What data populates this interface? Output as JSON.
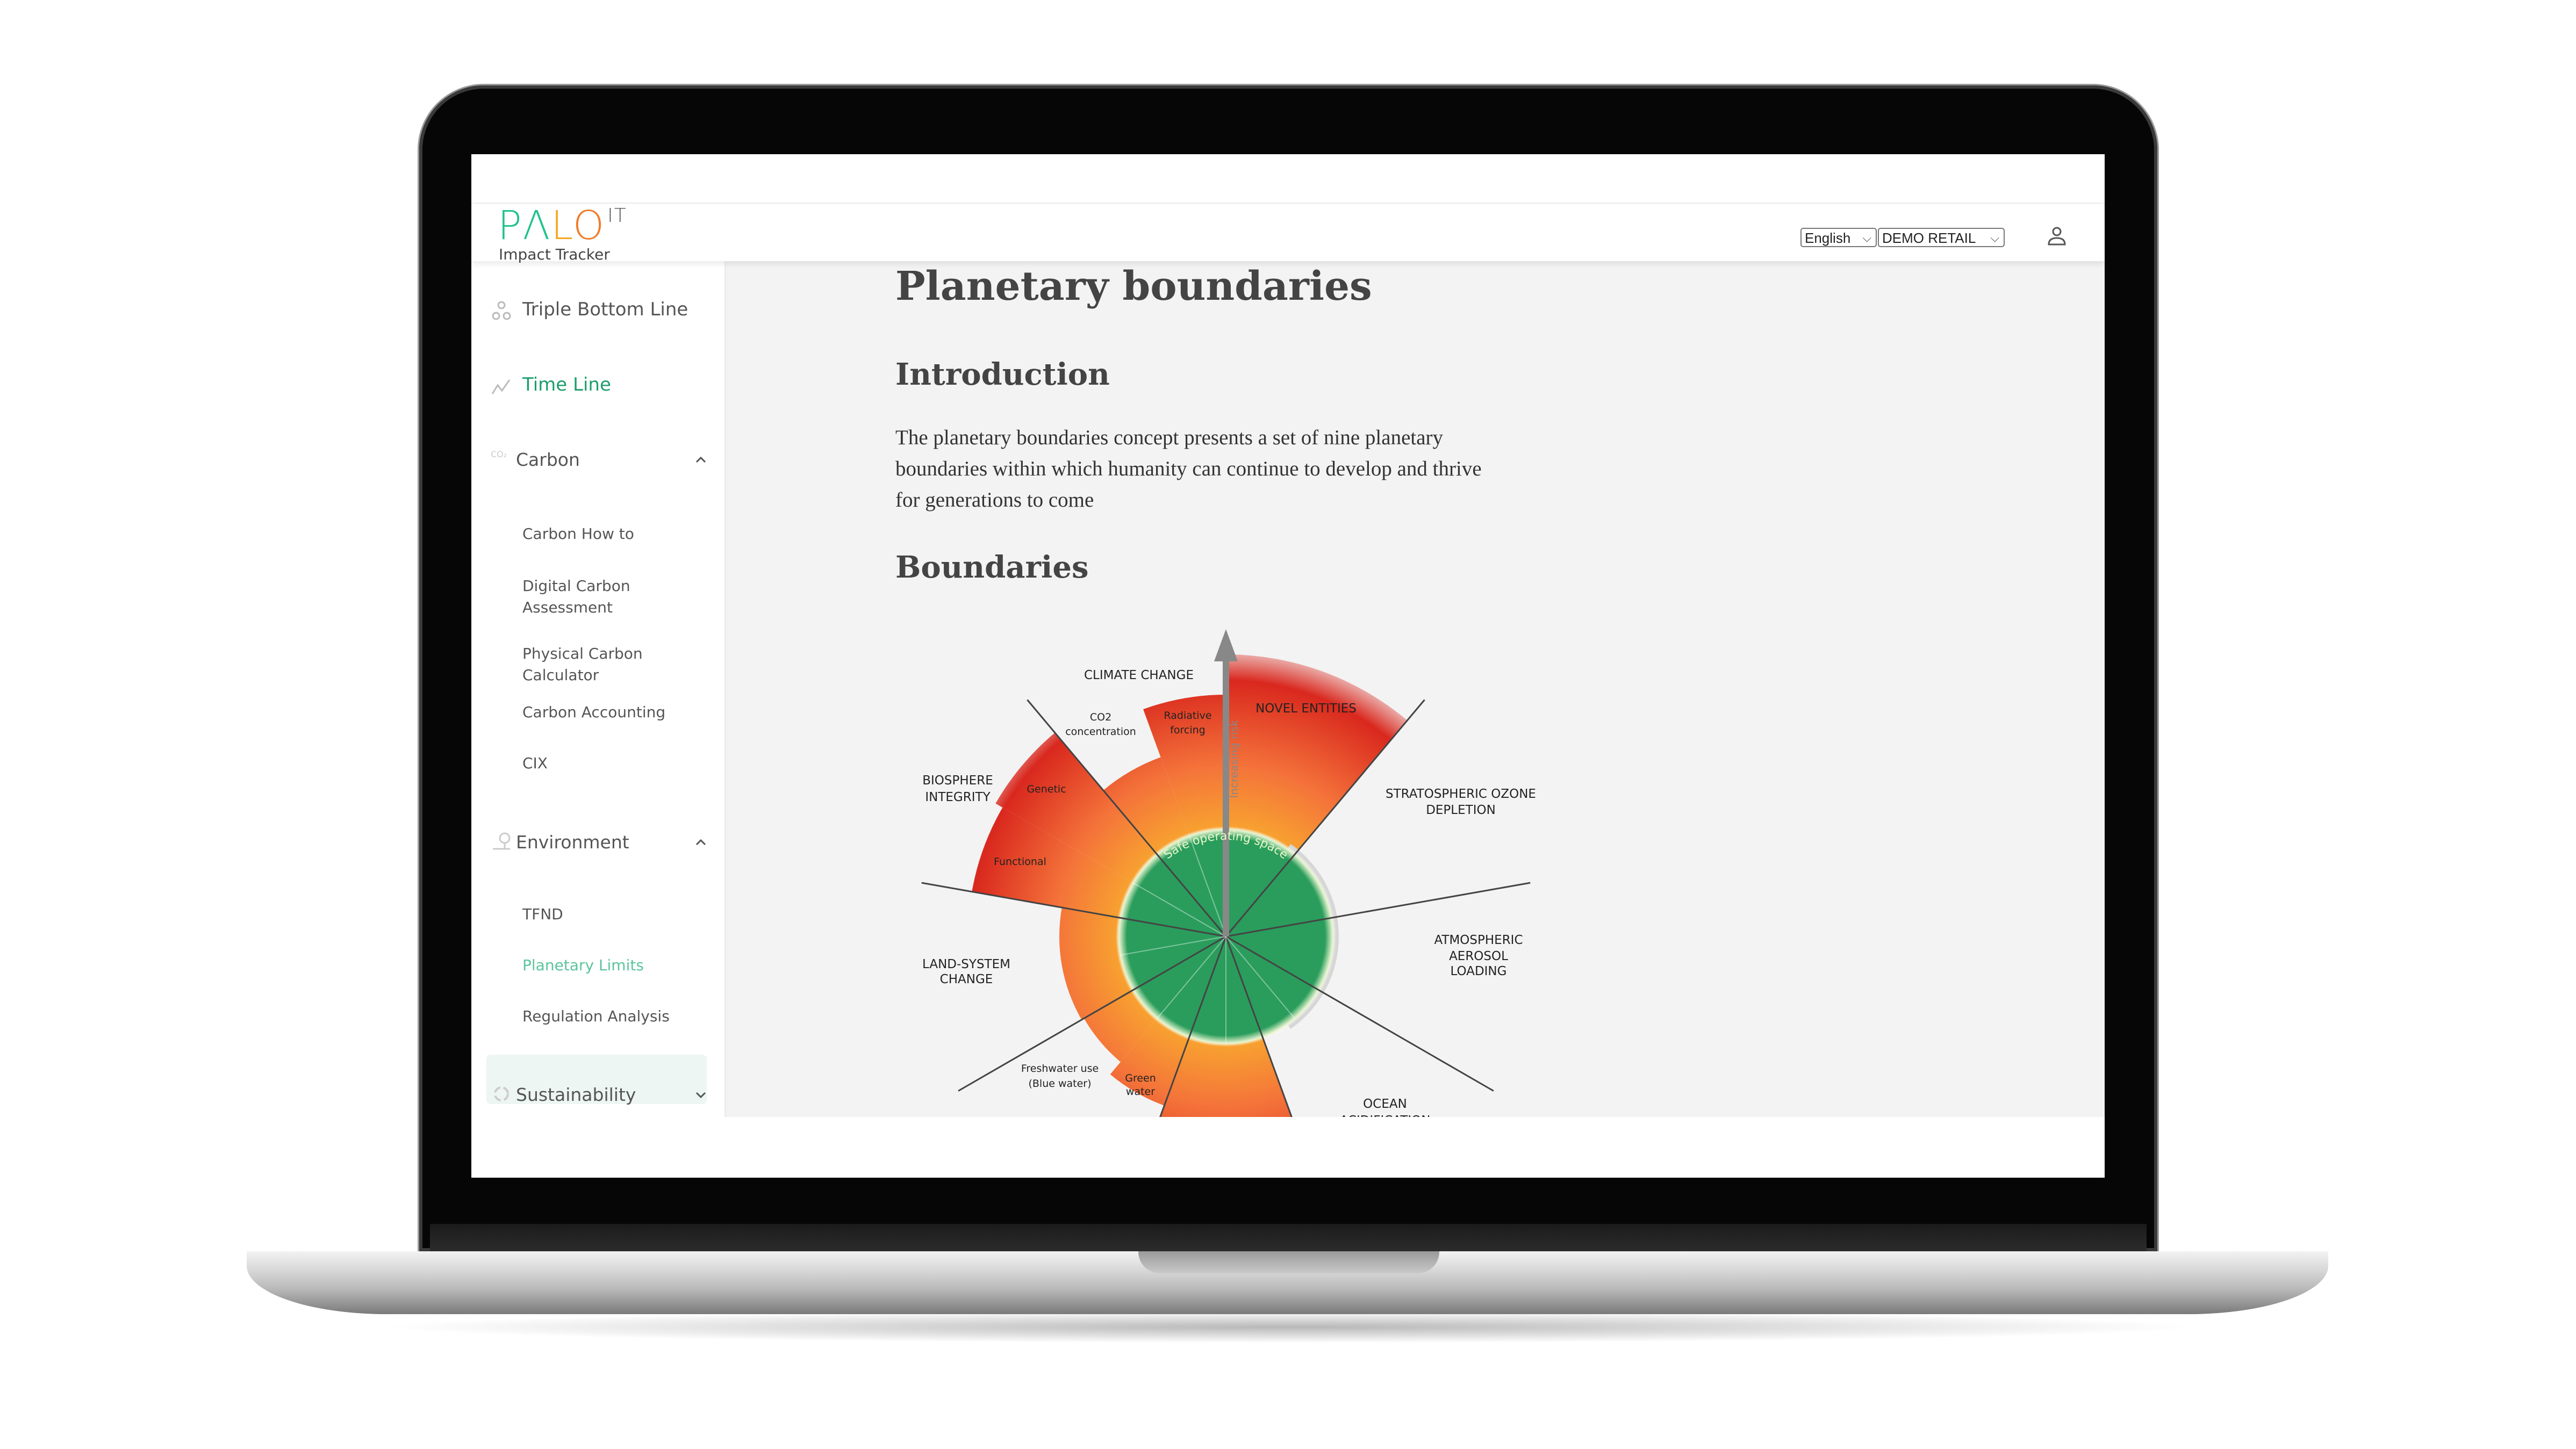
{
  "app": {
    "logo_text": "PALO IT",
    "logo_sub": "Impact Tracker"
  },
  "header": {
    "language": "English",
    "organization": "DEMO RETAIL",
    "user_icon": "user-icon"
  },
  "sidebar": {
    "triple_bottom_line": "Triple Bottom Line",
    "time_line": "Time Line",
    "carbon": {
      "label": "Carbon",
      "items": [
        "Carbon How to",
        "Digital Carbon Assessment",
        "Physical Carbon Calculator",
        "Carbon Accounting",
        "CIX"
      ]
    },
    "environment": {
      "label": "Environment",
      "items": [
        "TFND",
        "Planetary Limits",
        "Regulation Analysis"
      ]
    },
    "sustainability": "Sustainability",
    "active_item": "Planetary Limits"
  },
  "main": {
    "title": "Planetary boundaries",
    "intro_heading": "Introduction",
    "intro_lines": [
      "The planetary boundaries concept presents a set of nine planetary",
      "boundaries within which humanity can continue to develop and thrive",
      "for generations to come"
    ],
    "boundaries_heading": "Boundaries"
  },
  "diagram": {
    "climate_change": "CLIMATE CHANGE",
    "co2": [
      "CO2",
      "concentration"
    ],
    "radiative": [
      "Radiative",
      "forcing"
    ],
    "novel_entities": "NOVEL ENTITIES",
    "ozone": [
      "STRATOSPHERIC OZONE",
      "DEPLETION"
    ],
    "biosphere": [
      "BIOSPHERE",
      "INTEGRITY"
    ],
    "genetic": "Genetic",
    "functional": "Functional",
    "aerosol": [
      "ATMOSPHERIC",
      "AEROSOL",
      "LOADING"
    ],
    "land": [
      "LAND-SYSTEM",
      "CHANGE"
    ],
    "blue_water": [
      "Freshwater use",
      "(Blue water)"
    ],
    "green_water": [
      "Green",
      "water"
    ],
    "ocean": [
      "OCEAN",
      "ACIDIFICATION"
    ],
    "safe_space": "Safe operating space",
    "increasing_risk": "Increasing risk",
    "colors": {
      "safe": "#2a9d5c",
      "low_risk": "#f8a62f",
      "mid_risk": "#f4733a",
      "high_risk": "#d9281e"
    }
  },
  "chatbot": {
    "icon": "robot-icon",
    "color": "#1f9e6e"
  }
}
